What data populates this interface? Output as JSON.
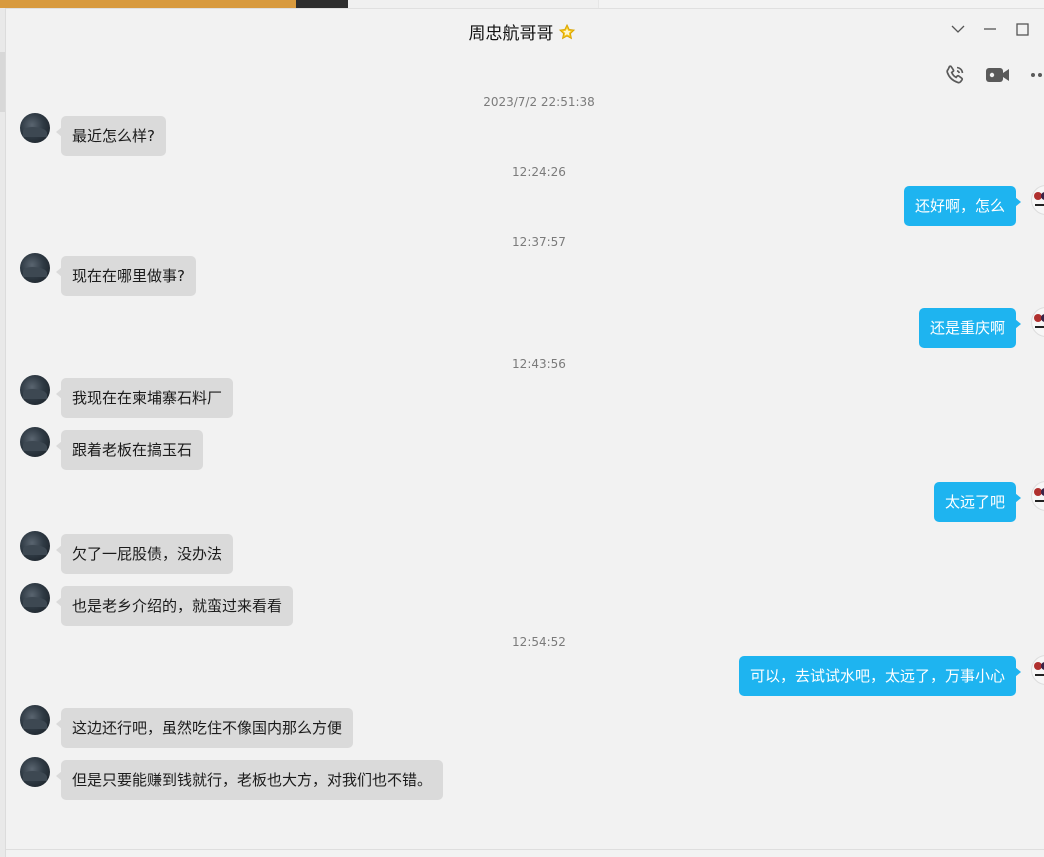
{
  "window": {
    "title": "周忠航哥哥",
    "icons": {
      "favorite": "star-icon",
      "dropdown": "chevron-down-icon",
      "minimize": "minimize-icon",
      "maximize": "maximize-icon",
      "call": "phone-icon",
      "video": "video-camera-icon",
      "more": "more-icon"
    }
  },
  "colors": {
    "outgoing_bubble": "#1eb4f0",
    "incoming_bubble": "#dadada",
    "background": "#f2f2f2",
    "star": "#f5c518"
  },
  "messages": {
    "t1": "2023/7/2 22:51:38",
    "m1": "最近怎么样?",
    "t2": "12:24:26",
    "m2": "还好啊，怎么",
    "t3": "12:37:57",
    "m3": "现在在哪里做事?",
    "m4": "还是重庆啊",
    "t4": "12:43:56",
    "m5": "我现在在柬埔寨石料厂",
    "m6": "跟着老板在搞玉石",
    "m7": "太远了吧",
    "m8": "欠了一屁股债，没办法",
    "m9": "也是老乡介绍的，就蛮过来看看",
    "t5": "12:54:52",
    "m10": "可以，去试试水吧，太远了，万事小心",
    "m11": "这边还行吧，虽然吃住不像国内那么方便",
    "m12": "但是只要能赚到钱就行，老板也大方，对我们也不错。"
  }
}
